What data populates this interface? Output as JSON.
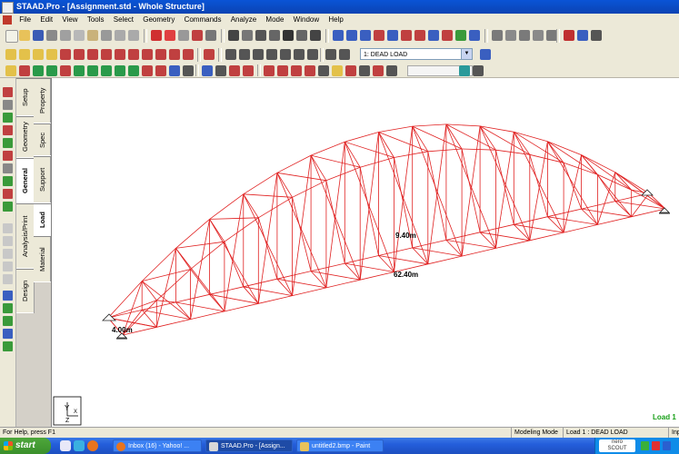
{
  "window": {
    "title": "STAAD.Pro - [Assignment.std - Whole Structure]"
  },
  "menu": {
    "items": [
      "File",
      "Edit",
      "View",
      "Tools",
      "Select",
      "Geometry",
      "Commands",
      "Analyze",
      "Mode",
      "Window",
      "Help"
    ]
  },
  "toolbar": {
    "load_case_select": "1: DEAD LOAD",
    "load_case_options": [
      "1: DEAD LOAD"
    ]
  },
  "tabs": {
    "page_control": [
      "Setup",
      "Geometry",
      "General",
      "Analysis/Print",
      "Design"
    ],
    "general_subtabs": [
      "Property",
      "Spec",
      "Support",
      "Load",
      "Material"
    ]
  },
  "viewport": {
    "labels": {
      "span_length": "62.40m",
      "rise_height": "9.40m",
      "deck_width": "4.00m"
    },
    "load_label": "Load 1",
    "axis_triad": {
      "y": "Y",
      "x": "X",
      "z": "Z"
    },
    "colors": {
      "members": "#e02020",
      "load_label": "#18a018"
    }
  },
  "status": {
    "help": "For Help, press F1",
    "mode": "Modeling Mode",
    "load": "Load 1 : DEAD LOAD",
    "extra": "Inp"
  },
  "taskbar": {
    "start": "start",
    "tasks": [
      {
        "label": "Inbox (16) - Yahoo! ...",
        "icon": "firefox-icon"
      },
      {
        "label": "STAAD.Pro - [Assign...",
        "icon": "staad-icon"
      },
      {
        "label": "untitled2.bmp - Paint",
        "icon": "paint-icon"
      }
    ],
    "tray": {
      "brand": "nero",
      "brand_sub": "SCOUT"
    }
  }
}
